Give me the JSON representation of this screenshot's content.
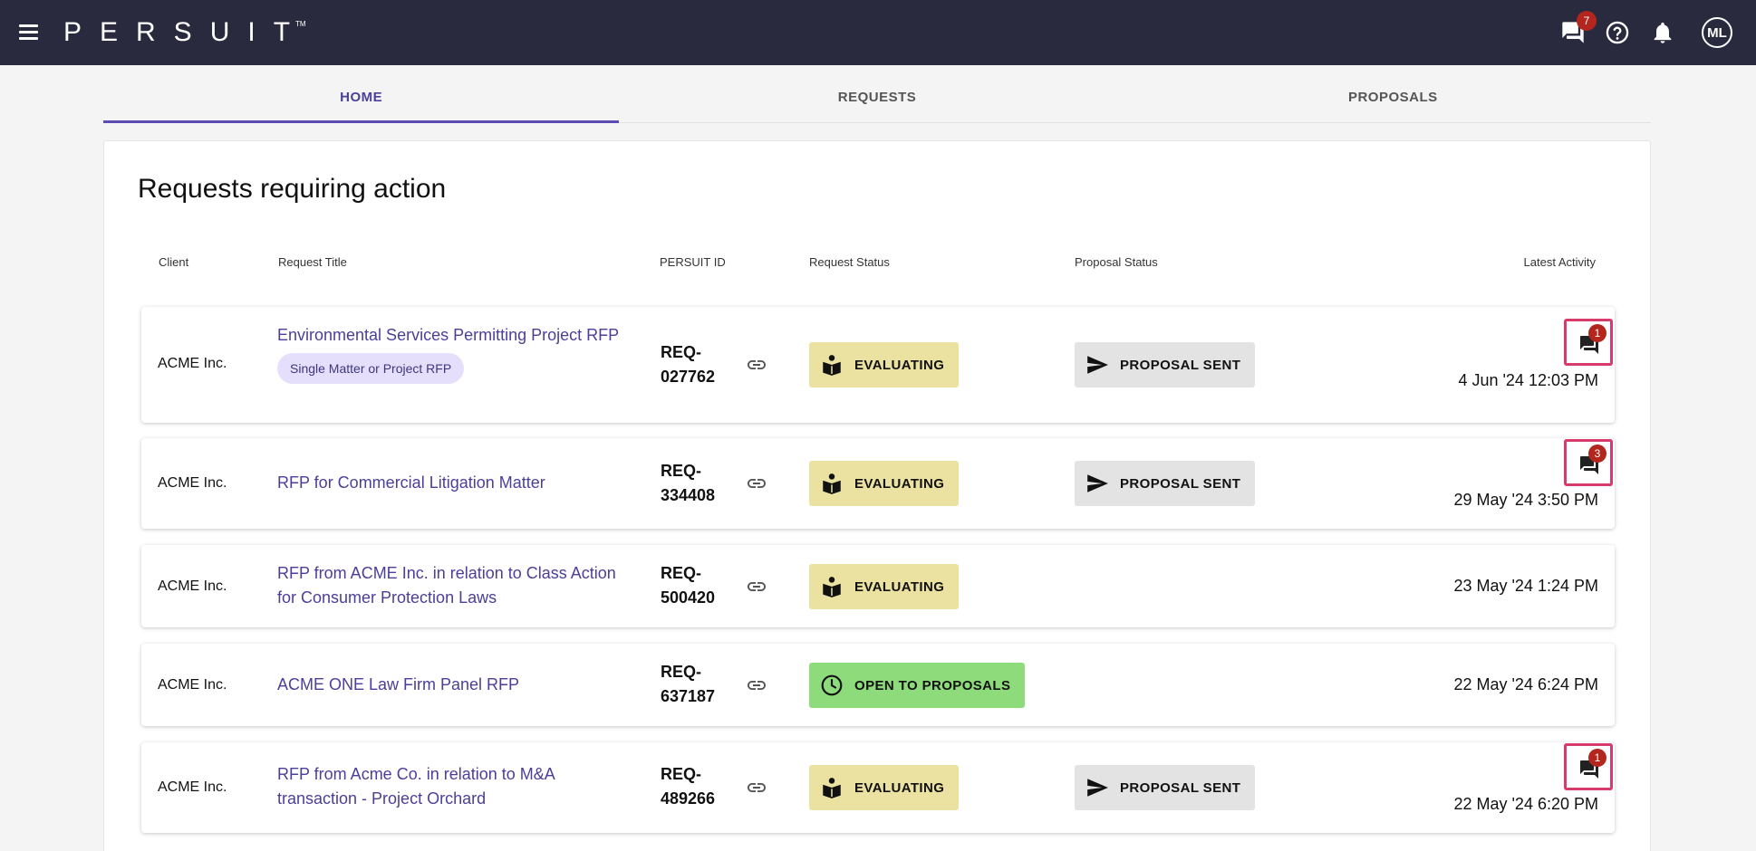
{
  "app": {
    "logo_text": "PERSUIT",
    "logo_tm": "TM"
  },
  "topbar": {
    "messages_badge": "7",
    "avatar_initials": "ML"
  },
  "tabs": [
    {
      "label": "HOME",
      "active": true
    },
    {
      "label": "REQUESTS",
      "active": false
    },
    {
      "label": "PROPOSALS",
      "active": false
    }
  ],
  "section": {
    "title": "Requests requiring action"
  },
  "columns": {
    "client": "Client",
    "request_title": "Request Title",
    "persuit_id": "PERSUIT ID",
    "request_status": "Request Status",
    "proposal_status": "Proposal Status",
    "latest_activity": "Latest Activity"
  },
  "rows": [
    {
      "client": "ACME Inc.",
      "title": "Environmental Services Permitting Project RFP",
      "tag": "Single Matter or Project RFP",
      "id": "REQ-027762",
      "request_status": "EVALUATING",
      "proposal_status": "PROPOSAL SENT",
      "unread_messages": "1",
      "latest_activity": "4 Jun '24 12:03 PM"
    },
    {
      "client": "ACME Inc.",
      "title": "RFP for Commercial Litigation Matter",
      "id": "REQ-334408",
      "request_status": "EVALUATING",
      "proposal_status": "PROPOSAL SENT",
      "unread_messages": "3",
      "latest_activity": "29 May '24 3:50 PM"
    },
    {
      "client": "ACME Inc.",
      "title": "RFP from ACME Inc. in relation to Class Action for Consumer Protection Laws",
      "id": "REQ-500420",
      "request_status": "EVALUATING",
      "latest_activity": "23 May '24 1:24 PM"
    },
    {
      "client": "ACME Inc.",
      "title": "ACME ONE Law Firm Panel RFP",
      "id": "REQ-637187",
      "request_status": "OPEN TO PROPOSALS",
      "latest_activity": "22 May '24 6:24 PM"
    },
    {
      "client": "ACME Inc.",
      "title": "RFP from Acme Co. in relation to M&A transaction - Project Orchard",
      "id": "REQ-489266",
      "request_status": "EVALUATING",
      "proposal_status": "PROPOSAL SENT",
      "unread_messages": "1",
      "latest_activity": "22 May '24 6:20 PM"
    }
  ],
  "colors": {
    "topbar": "#2a2a3e",
    "accent": "#5a4cb2",
    "evaluating": "#ebe2a1",
    "open": "#8edb7c",
    "proposal_sent": "#e3e3e3",
    "highlight": "#d63b6b",
    "badge": "#b3261e"
  },
  "icons": [
    "menu-icon",
    "chat-icon",
    "help-icon",
    "bell-icon",
    "link-icon",
    "evaluate-icon",
    "clock-icon",
    "send-icon"
  ]
}
